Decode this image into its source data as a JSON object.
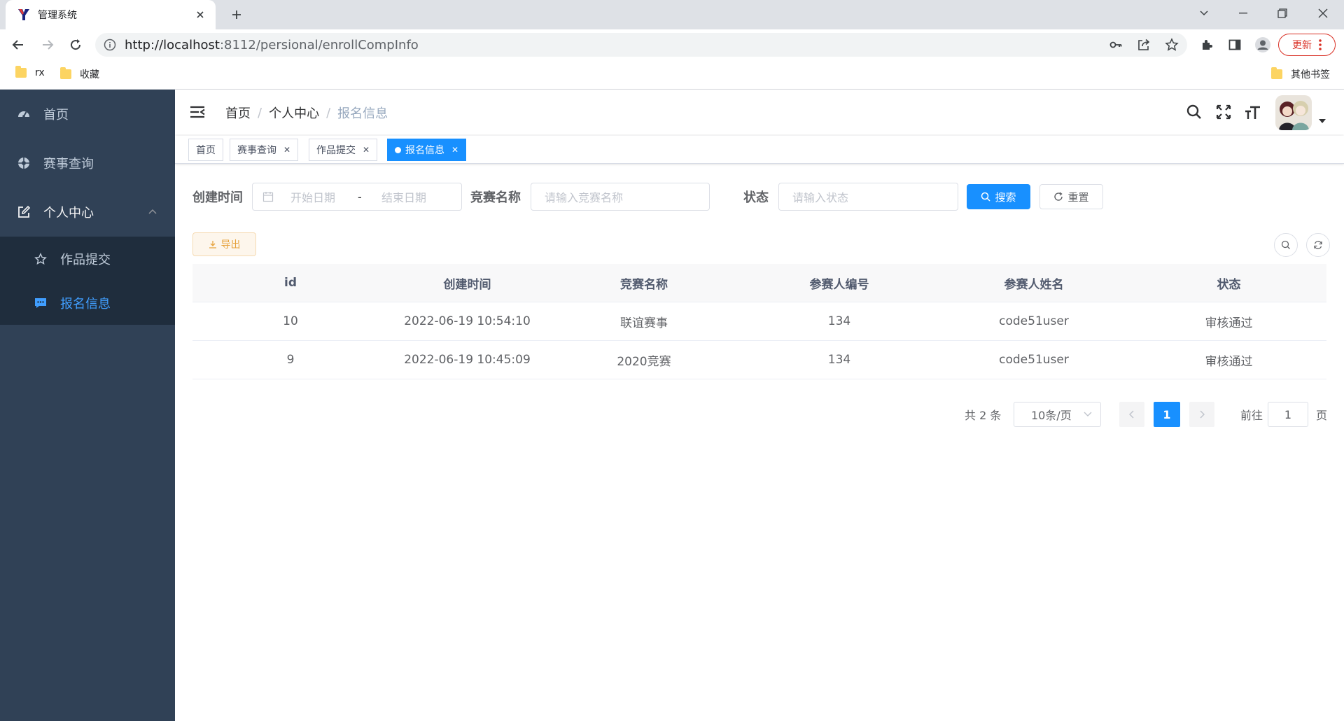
{
  "browser": {
    "tab_title": "管理系统",
    "url_host": "http://localhost",
    "url_path": ":8112/persional/enrollCompInfo",
    "update_label": "更新",
    "bookmarks": [
      "rx",
      "收藏"
    ],
    "other_bookmarks": "其他书签"
  },
  "sidebar": {
    "items": [
      {
        "label": "首页",
        "icon": "dashboard-icon"
      },
      {
        "label": "赛事查询",
        "icon": "aperture-icon"
      },
      {
        "label": "个人中心",
        "icon": "edit-icon"
      }
    ],
    "sub_items": [
      {
        "label": "作品提交",
        "icon": "star-icon"
      },
      {
        "label": "报名信息",
        "icon": "message-icon"
      }
    ]
  },
  "navbar": {
    "breadcrumb": [
      "首页",
      "个人中心",
      "报名信息"
    ]
  },
  "tags": [
    {
      "label": "首页"
    },
    {
      "label": "赛事查询"
    },
    {
      "label": "作品提交"
    },
    {
      "label": "报名信息"
    }
  ],
  "filter": {
    "created_label": "创建时间",
    "start_placeholder": "开始日期",
    "range_sep": "-",
    "end_placeholder": "结束日期",
    "comp_label": "竞赛名称",
    "comp_placeholder": "请输入竞赛名称",
    "status_label": "状态",
    "status_placeholder": "请输入状态",
    "search_label": "搜索",
    "reset_label": "重置",
    "export_label": "导出"
  },
  "table": {
    "columns": [
      "id",
      "创建时间",
      "竞赛名称",
      "参赛人编号",
      "参赛人姓名",
      "状态"
    ],
    "rows": [
      [
        "10",
        "2022-06-19 10:54:10",
        "联谊赛事",
        "134",
        "code51user",
        "审核通过"
      ],
      [
        "9",
        "2022-06-19 10:45:09",
        "2020竞赛",
        "134",
        "code51user",
        "审核通过"
      ]
    ]
  },
  "pagination": {
    "total": "共 2 条",
    "page_size": "10条/页",
    "current": "1",
    "goto_label": "前往",
    "goto_value": "1",
    "page_suffix": "页"
  },
  "colors": {
    "primary": "#1890ff",
    "sidebar_bg": "#304156",
    "submenu_bg": "#1f2d3d",
    "warning": "#e6a23c"
  }
}
